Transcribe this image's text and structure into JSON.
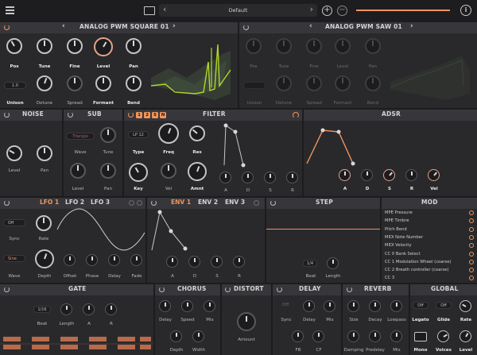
{
  "topbar": {
    "preset_name": "Default",
    "prev_arrow": "‹",
    "next_arrow": "›",
    "add_symbol": "+",
    "remove_symbol": "−",
    "info_symbol": "i"
  },
  "osc1": {
    "title": "ANALOG PWM SQUARE 01",
    "prev_arrow": "‹",
    "next_arrow": "›",
    "unison_value": "1.0",
    "row1": [
      "Pos",
      "Tune",
      "Fine",
      "Level",
      "Pan"
    ],
    "row2": [
      "Unison",
      "Detune",
      "Spread",
      "Formant",
      "Bend"
    ]
  },
  "osc2": {
    "title": "ANALOG PWM SAW 01",
    "prev_arrow": "‹",
    "next_arrow": "›",
    "row1": [
      "Pos",
      "Tune",
      "Fine",
      "Level",
      "Pan"
    ],
    "row2": [
      "Unison",
      "Detune",
      "Spread",
      "Formant",
      "Bend"
    ]
  },
  "noise": {
    "title": "NOISE",
    "labels": [
      "Level",
      "Pan"
    ]
  },
  "sub": {
    "title": "SUB",
    "wave_value": "Triangle",
    "labels": [
      "Wave",
      "Tune",
      "Level",
      "Pan"
    ]
  },
  "filter": {
    "title": "FILTER",
    "routes": [
      "1",
      "2",
      "S",
      "N"
    ],
    "type_value": "LP 12",
    "labels": [
      "Type",
      "Freq",
      "Res",
      "Key",
      "Vel",
      "Amnt"
    ],
    "env_labels": [
      "A",
      "D",
      "S",
      "R"
    ]
  },
  "adsr": {
    "title": "ADSR",
    "labels": [
      "A",
      "D",
      "S",
      "R",
      "Vel"
    ]
  },
  "lfo": {
    "tabs": [
      "LFO 1",
      "LFO 2",
      "LFO 3"
    ],
    "sync_value": "Off",
    "wave_value": "Sine",
    "labels": [
      "Sync",
      "Rate",
      "Wave",
      "Depth",
      "Offset",
      "Phase",
      "Delay",
      "Fade"
    ]
  },
  "env": {
    "tabs": [
      "ENV 1",
      "ENV 2",
      "ENV 3"
    ],
    "labels": [
      "A",
      "D",
      "S",
      "R"
    ]
  },
  "step": {
    "title": "STEP",
    "beat_value": "1/4",
    "labels": [
      "Beat",
      "Length"
    ]
  },
  "mod": {
    "title": "MOD",
    "items": [
      "MPE Pressure",
      "MPE Timbre",
      "Pitch Bend",
      "MIDI Note Number",
      "MIDI Velocity",
      "CC 0 Bank Select",
      "CC 1 Modulation Wheel (coarse)",
      "CC 2 Breath controller (coarse)",
      "CC 3"
    ]
  },
  "gate": {
    "title": "GATE",
    "beat_value": "1/16",
    "labels": [
      "Beat",
      "Length",
      "A",
      "R"
    ]
  },
  "chorus": {
    "title": "CHORUS",
    "labels": [
      "Delay",
      "Speed",
      "Mix",
      "Depth",
      "Width"
    ]
  },
  "distort": {
    "title": "DISTORT",
    "labels": [
      "Amount"
    ]
  },
  "delay": {
    "title": "DELAY",
    "sync_value": "Off",
    "labels": [
      "Sync",
      "Delay",
      "Mix",
      "FB",
      "CF"
    ]
  },
  "reverb": {
    "title": "REVERB",
    "labels": [
      "Size",
      "Decay",
      "Lowpass",
      "Damping",
      "Predelay",
      "Mix"
    ]
  },
  "global": {
    "title": "GLOBAL",
    "legato_value": "Off",
    "glide_value": "Off",
    "labels": [
      "Legato",
      "Glide",
      "Rate",
      "Mono",
      "Voices",
      "Level"
    ]
  },
  "colors": {
    "accent": "#f0955c",
    "osc_wave": "#b4d62a",
    "panel": "#29292c",
    "header": "#37373b"
  }
}
